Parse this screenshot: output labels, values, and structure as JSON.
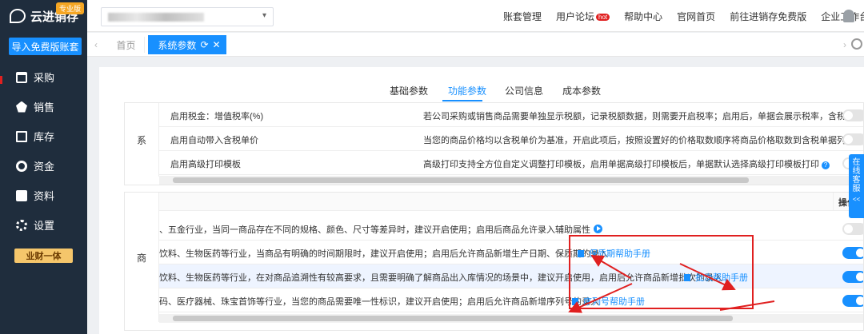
{
  "app": {
    "name": "云进销存",
    "badge": "专业版"
  },
  "sidebar": {
    "import_button": "导入免费版账套",
    "items": [
      {
        "label": "采购",
        "icon": "cart-icon"
      },
      {
        "label": "销售",
        "icon": "sales-icon"
      },
      {
        "label": "库存",
        "icon": "warehouse-icon"
      },
      {
        "label": "资金",
        "icon": "fund-icon"
      },
      {
        "label": "资料",
        "icon": "document-icon"
      },
      {
        "label": "设置",
        "icon": "gear-icon"
      }
    ],
    "promo": "业财一体"
  },
  "topbar": {
    "account_arrow": "▾",
    "links": [
      "账套管理",
      "用户论坛",
      "帮助中心",
      "官网首页",
      "前往进销存免费版",
      "企业工作台"
    ],
    "hot_badge": "hot"
  },
  "tabbar": {
    "home_tab": "首页",
    "active_tab": "系统参数",
    "refresh_glyph": "⟳",
    "close_glyph": "✕",
    "left_arrow": "‹",
    "right_arrow": "›"
  },
  "subtabs": [
    "基础参数",
    "功能参数",
    "公司信息",
    "成本参数"
  ],
  "section_a": {
    "label": "系",
    "rows": [
      {
        "name": "启用税金：增值税率(%)",
        "desc": "若公司采购或销售商品需要单独显示税额，记录税额数据，则需要开启税率；启用后，单据会展示税率，含税单价",
        "on": false
      },
      {
        "name": "启用自动带入含税单价",
        "desc": "当您的商品价格均以含税单价为基准，开启此项后，按照设置好的价格取数顺序将商品价格取数到含税单据列，会",
        "on": false
      },
      {
        "name": "启用高级打印模板",
        "desc": "高级打印支持全方位自定义调整打印模板，启用单据高级打印模板后，单据默认选择高级打印模板打印",
        "on": false
      }
    ]
  },
  "section_b": {
    "label": "商",
    "op_header": "操作",
    "rows": [
      {
        "desc": "、五金行业，当同一商品存在不同的规格、颜色、尺寸等差异时，建议开启使用；启用后商品允许录入辅助属性",
        "link": "",
        "on": false
      },
      {
        "desc": "饮料、生物医药等行业，当商品有明确的时间期限时，建议开启使用；启用后允许商品新增生产日期、保质期的录入",
        "link": "保质期帮助手册",
        "on": true
      },
      {
        "desc": "饮料、生物医药等行业，在对商品追溯性有较高要求，且需要明确了解商品出入库情况的场景中，建议开启使用，启用后允许商品新增批次的录入",
        "link": "批次帮助手册",
        "on": true
      },
      {
        "desc": "码、医疗器械、珠宝首饰等行业，当您的商品需要唯一性标识，建议开启使用；启用后允许商品新增序列号的录入",
        "link": "序列号帮助手册",
        "on": true
      }
    ]
  },
  "service": {
    "label": "在线客服",
    "collapse": "<<"
  }
}
